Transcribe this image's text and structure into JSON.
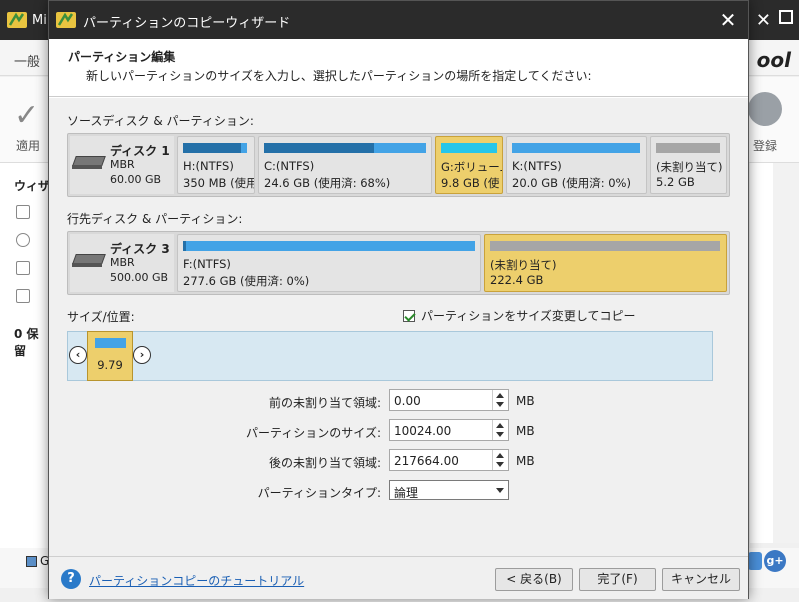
{
  "background": {
    "app_title": "Mi",
    "menu_first": "一般",
    "brand": "ool",
    "apply_label": "適用",
    "register_label": "登録",
    "sidebar_heading": "ウィザ",
    "sidebar_pending": "0 保留",
    "status_item": "G"
  },
  "dialog": {
    "title": "パーティションのコピーウィザード",
    "heading": "パーティション編集",
    "description": "新しいパーティションのサイズを入力し、選択したパーティションの場所を指定してください:"
  },
  "source": {
    "label": "ソースディスク & パーティション:",
    "disk": {
      "name": "ディスク 1",
      "type": "MBR",
      "size": "60.00 GB"
    },
    "partitions": [
      {
        "label": "H:(NTFS)",
        "size": "350 MB (使用",
        "used_ratio": 0.9,
        "selected": false,
        "unallocated": false
      },
      {
        "label": "C:(NTFS)",
        "size": "24.6 GB (使用済: 68%)",
        "used_ratio": 0.68,
        "selected": false,
        "unallocated": false
      },
      {
        "label": "G:ボリューム",
        "size": "9.8 GB (使",
        "used_ratio": 0.0,
        "selected": true,
        "unallocated": false
      },
      {
        "label": "K:(NTFS)",
        "size": "20.0 GB (使用済: 0%)",
        "used_ratio": 0.0,
        "selected": false,
        "unallocated": false
      },
      {
        "label": "(未割り当て)",
        "size": "5.2 GB",
        "used_ratio": 0.0,
        "selected": false,
        "unallocated": true
      }
    ]
  },
  "target": {
    "label": "行先ディスク & パーティション:",
    "disk": {
      "name": "ディスク 3",
      "type": "MBR",
      "size": "500.00 GB"
    },
    "partitions": [
      {
        "label": "F:(NTFS)",
        "size": "277.6 GB (使用済: 0%)",
        "selected": false,
        "unallocated": false
      },
      {
        "label": "(未割り当て)",
        "size": "222.4 GB",
        "selected": true,
        "unallocated": true
      }
    ]
  },
  "resize": {
    "label": "サイズ/位置:",
    "checkbox_label": "パーティションをサイズ変更してコピー",
    "checkbox_checked": true,
    "block_value": "9.79"
  },
  "fields": {
    "before": {
      "label": "前の未割り当て領域:",
      "value": "0.00",
      "unit": "MB"
    },
    "size": {
      "label": "パーティションのサイズ:",
      "value": "10024.00",
      "unit": "MB"
    },
    "after": {
      "label": "後の未割り当て領域:",
      "value": "217664.00",
      "unit": "MB"
    },
    "type": {
      "label": "パーティションタイプ:",
      "value": "論理"
    }
  },
  "footer": {
    "help_icon": "?",
    "help_link": "パーティションコピーのチュートリアル",
    "back": "< 戻る(B)",
    "finish": "完了(F)",
    "cancel": "キャンセル"
  },
  "colors": {
    "accent": "#43a3e6",
    "selected": "#edcf6c",
    "titlebar": "#2b2b2b"
  }
}
